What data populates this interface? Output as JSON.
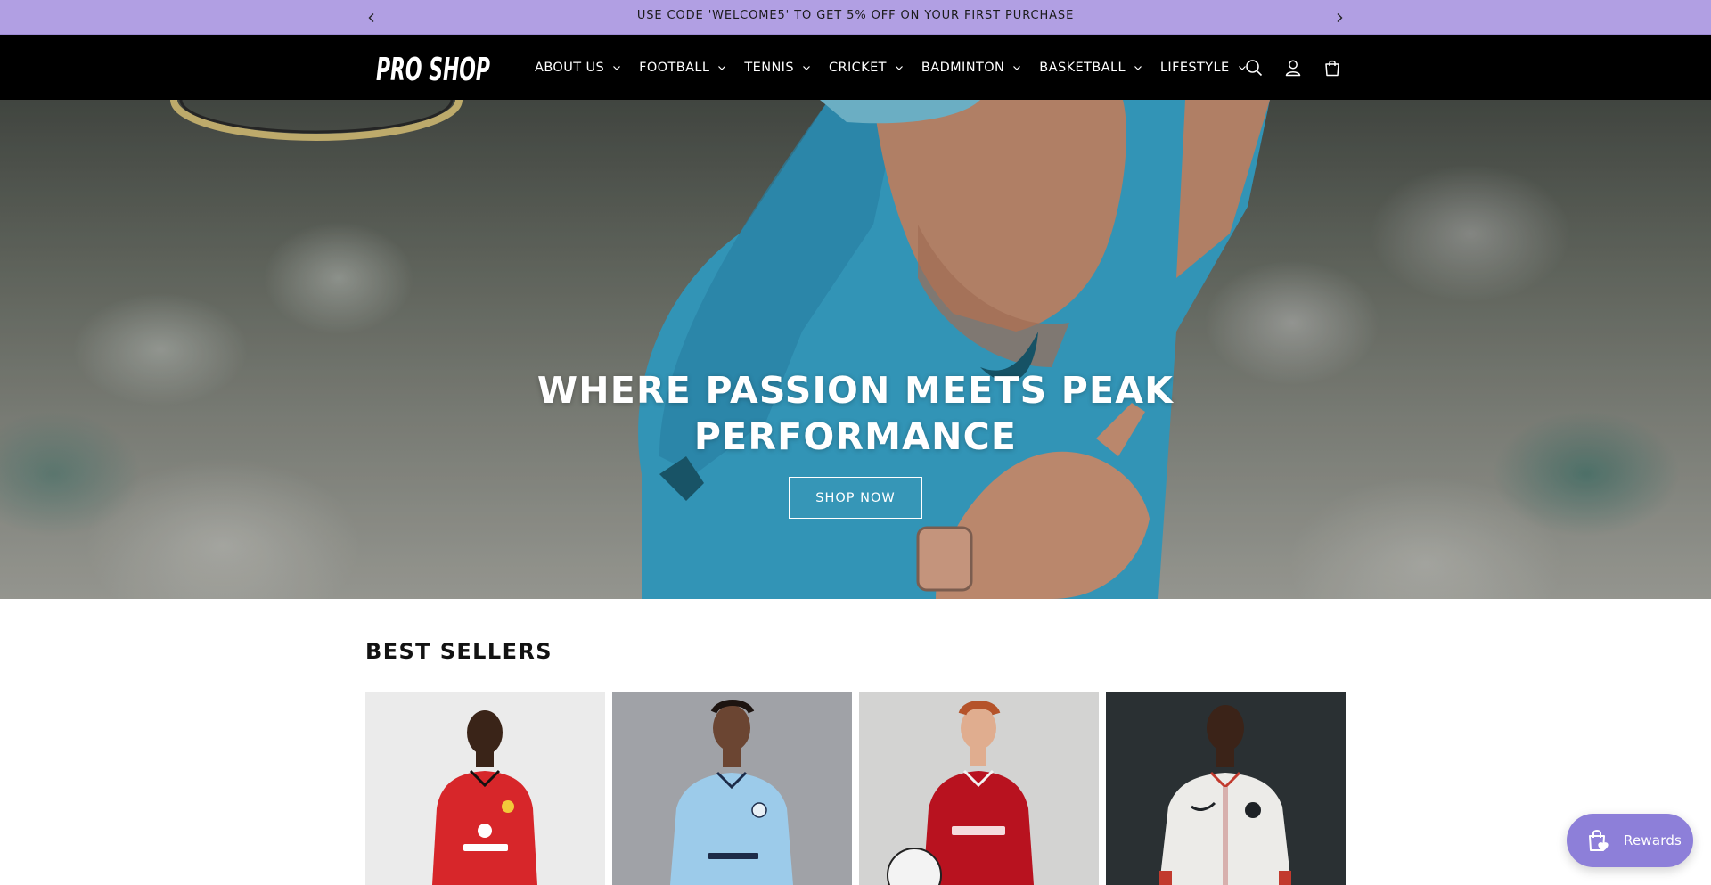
{
  "announcement": {
    "message": "USE CODE 'WELCOME5' TO GET 5% OFF ON YOUR FIRST PURCHASE",
    "prev_icon": "chevron-left-icon",
    "next_icon": "chevron-right-icon"
  },
  "header": {
    "logo_text": "PRO SHOP",
    "nav": [
      {
        "label": "ABOUT US"
      },
      {
        "label": "FOOTBALL"
      },
      {
        "label": "TENNIS"
      },
      {
        "label": "CRICKET"
      },
      {
        "label": "BADMINTON"
      },
      {
        "label": "BASKETBALL"
      },
      {
        "label": "LIFESTYLE"
      }
    ],
    "icons": [
      "search-icon",
      "account-icon",
      "cart-icon"
    ]
  },
  "hero": {
    "title": "WHERE PASSION MEETS PEAK PERFORMANCE",
    "button_label": "SHOP NOW"
  },
  "best_sellers": {
    "title": "BEST SELLERS"
  },
  "rewards": {
    "label": "Rewards"
  },
  "colors": {
    "announcement_bg": "#b19fe3",
    "header_bg": "#000000",
    "rewards_bg": "#8d7fd9"
  }
}
